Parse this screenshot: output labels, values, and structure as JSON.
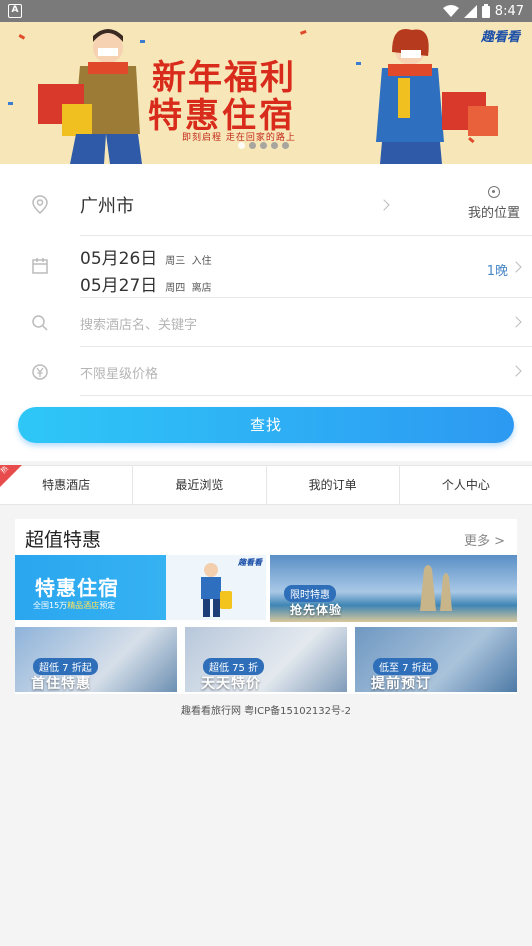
{
  "status_bar": {
    "time": "8:47",
    "app_icon": "A"
  },
  "banner": {
    "line1": "新年福利",
    "line2": "特惠住宿",
    "subtitle": "即刻启程 走在回家的路上",
    "logo": "趣看看",
    "slides": 5,
    "active_slide": 0
  },
  "search": {
    "city": "广州市",
    "my_location": "我的位置",
    "checkin_date": "05月26日",
    "checkin_weekday": "周三",
    "checkin_label": "入住",
    "checkout_date": "05月27日",
    "checkout_weekday": "周四",
    "checkout_label": "离店",
    "nights": "1晚",
    "keyword_placeholder": "搜索酒店名、关键字",
    "price_placeholder": "不限星级价格",
    "button": "查找"
  },
  "tabs": {
    "hot_badge": "热",
    "items": [
      "特惠酒店",
      "最近浏览",
      "我的订单",
      "个人中心"
    ]
  },
  "deals": {
    "title": "超值特惠",
    "more": "更多 >",
    "card1": {
      "title": "特惠住宿",
      "subtitle_a": "全国15万",
      "subtitle_b": "精品酒店",
      "subtitle_c": "预定",
      "logo": "趣看看"
    },
    "card2": {
      "tag": "限时特惠",
      "title": "抢先体验"
    },
    "card3": {
      "tag": "超低 7 折起",
      "title": "首住特惠"
    },
    "card4": {
      "tag": "超低 75 折",
      "title": "天天特价"
    },
    "card5": {
      "tag": "低至 7 折起",
      "title": "提前预订"
    }
  },
  "footer": {
    "text": "趣看看旅行网 粤ICP备15102132号-2"
  },
  "colors": {
    "accent": "#2d99f2",
    "banner_bg": "#f7e7b8",
    "banner_text": "#d92b1b",
    "hot": "#e84b4b"
  }
}
